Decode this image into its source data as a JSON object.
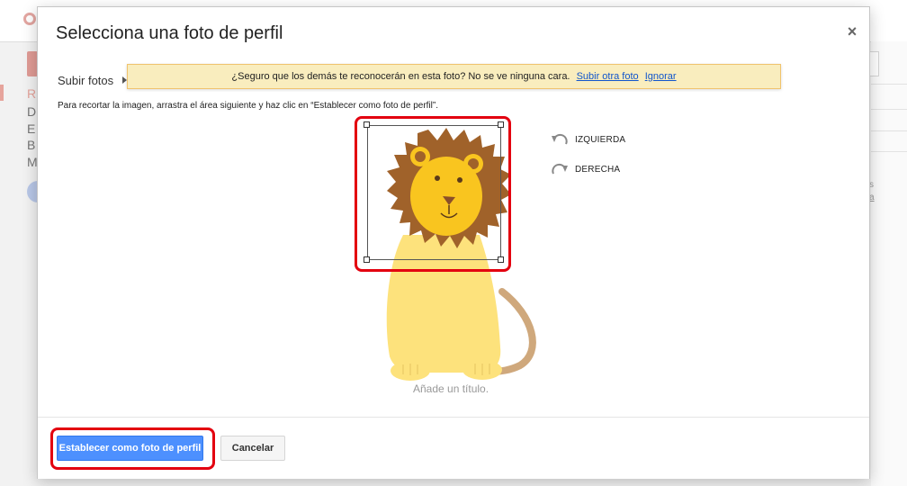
{
  "background": {
    "letters": [
      "R",
      "D",
      "E",
      "B",
      "M"
    ],
    "right_text": [
      "s",
      "a"
    ]
  },
  "dialog": {
    "title": "Selecciona una foto de perfil",
    "close_label": "×",
    "tab_upload": "Subir fotos",
    "warning": {
      "message": "¿Seguro que los demás te reconocerán en esta foto? No se ve ninguna cara.",
      "link_other": "Subir otra foto",
      "link_ignore": "Ignorar"
    },
    "instructions": "Para recortar la imagen, arrastra el área siguiente y haz clic en “Establecer como foto de perfil”.",
    "rotate_left": "IZQUIERDA",
    "rotate_right": "DERECHA",
    "caption_placeholder": "Añade un título.",
    "buttons": {
      "set_profile": "Establecer como foto de perfil",
      "cancel": "Cancelar"
    }
  },
  "icons": {
    "close": "close-icon",
    "rotate_left": "rotate-left-icon",
    "rotate_right": "rotate-right-icon"
  },
  "colors": {
    "primary_button": "#4d90fe",
    "warning_bg": "#f9edbe",
    "highlight": "#e3000f",
    "link": "#1155cc",
    "lion_mane": "#a0622a",
    "lion_face": "#f9c51f",
    "lion_body": "#fde27c"
  }
}
